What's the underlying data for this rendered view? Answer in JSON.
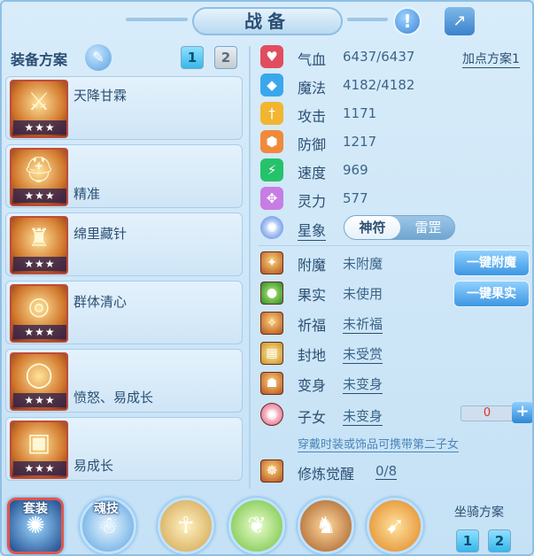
{
  "header": {
    "title": "战备",
    "alert_icon": "!",
    "share_icon": "↗"
  },
  "left": {
    "plan_label": "装备方案",
    "edit_icon": "✎",
    "tabs": [
      "1",
      "2"
    ],
    "items": [
      {
        "name": "天降甘霖",
        "stars": "★★★",
        "glyph": "⚔"
      },
      {
        "name": "精准",
        "stars": "★★★",
        "glyph": "⛑"
      },
      {
        "name": "绵里藏针",
        "stars": "★★★",
        "glyph": "♜"
      },
      {
        "name": "群体清心",
        "stars": "★★★",
        "glyph": "◎"
      },
      {
        "name": "愤怒、易成长",
        "stars": "★★★",
        "glyph": "◯"
      },
      {
        "name": "易成长",
        "stars": "★★★",
        "glyph": "▣"
      }
    ]
  },
  "stats": {
    "plan_link": "加点方案1",
    "rows": [
      {
        "name": "气血",
        "value": "6437/6437",
        "icon": "♥",
        "color": "#e24c5f"
      },
      {
        "name": "魔法",
        "value": "4182/4182",
        "icon": "◆",
        "color": "#3aa7ec"
      },
      {
        "name": "攻击",
        "value": "1171",
        "icon": "†",
        "color": "#f2b530"
      },
      {
        "name": "防御",
        "value": "1217",
        "icon": "⬢",
        "color": "#f08a3a"
      },
      {
        "name": "速度",
        "value": "969",
        "icon": "⚡",
        "color": "#26c26a"
      },
      {
        "name": "灵力",
        "value": "577",
        "icon": "✥",
        "color": "#c77de3"
      }
    ],
    "star_label": "星象",
    "toggle": [
      "神符",
      "雷罡"
    ]
  },
  "slots": {
    "rows": [
      {
        "name": "附魔",
        "value": "未附魔",
        "icon": "✦",
        "underline": false
      },
      {
        "name": "果实",
        "value": "未使用",
        "icon": "●",
        "underline": false
      },
      {
        "name": "祈福",
        "value": "未祈福",
        "icon": "✧",
        "underline": true
      },
      {
        "name": "封地",
        "value": "未受赏",
        "icon": "▤",
        "underline": true
      },
      {
        "name": "变身",
        "value": "未变身",
        "icon": "☗",
        "underline": true
      },
      {
        "name": "子女",
        "value": "未变身",
        "icon": "◉",
        "underline": true
      }
    ],
    "btn_enchant": "一键附魔",
    "btn_fruit": "一键果实",
    "child_count": "0",
    "plus": "+",
    "note": "穿戴时装或饰品可携带第二子女",
    "awaken_label": "修炼觉醒",
    "awaken_value": "0/8"
  },
  "bottom": {
    "tabs": [
      {
        "label": "套装",
        "glyph": "✺"
      },
      {
        "label": "魂技",
        "glyph": "☃"
      },
      {
        "label": "",
        "glyph": "☥"
      },
      {
        "label": "",
        "glyph": "❦"
      },
      {
        "label": "",
        "glyph": "♞"
      },
      {
        "label": "",
        "glyph": "➹"
      }
    ],
    "mount_label": "坐骑方案",
    "mount_tabs": [
      "1",
      "2"
    ]
  }
}
